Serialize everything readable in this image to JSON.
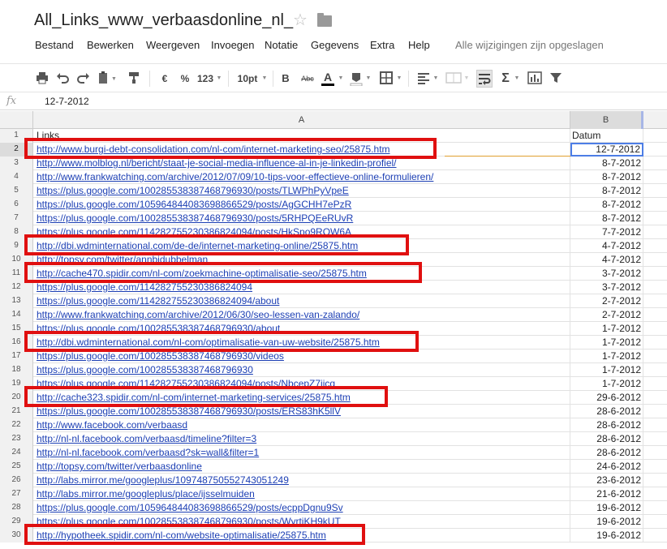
{
  "app": {
    "title": "All_Links_www_verbaasdonline_nl_",
    "save_status": "Alle wijzigingen zijn opgeslagen"
  },
  "menu": [
    "Bestand",
    "Bewerken",
    "Weergeven",
    "Invoegen",
    "Notatie",
    "Gegevens",
    "Extra",
    "Help"
  ],
  "toolbar": {
    "currency": "€",
    "percent": "%",
    "number_format": "123",
    "font_size": "10pt",
    "bold": "B",
    "strike": "Abc",
    "text_color": "A"
  },
  "formula": {
    "fx": "fx",
    "value": "12-7-2012"
  },
  "columns": {
    "a": "A",
    "b": "B"
  },
  "accent_colors": {
    "link": "#1c3fb4",
    "highlight_box": "#e01010",
    "selection": "#4d7ee6"
  },
  "rows": [
    {
      "n": "1",
      "a": "Links",
      "b": "Datum",
      "link": false
    },
    {
      "n": "2",
      "a": "http://www.burgi-debt-consolidation.com/nl-com/internet-marketing-seo/25875.htm",
      "b": "12-7-2012",
      "link": true
    },
    {
      "n": "3",
      "a": "http://www.molblog.nl/bericht/staat-je-social-media-influence-al-in-je-linkedin-profiel/",
      "b": "8-7-2012",
      "link": true
    },
    {
      "n": "4",
      "a": "http://www.frankwatching.com/archive/2012/07/09/10-tips-voor-effectieve-online-formulieren/",
      "b": "8-7-2012",
      "link": true
    },
    {
      "n": "5",
      "a": "https://plus.google.com/100285538387468796930/posts/TLWPhPyVpeE",
      "b": "8-7-2012",
      "link": true
    },
    {
      "n": "6",
      "a": "https://plus.google.com/105964844083698866529/posts/AgGCHH7ePzR",
      "b": "8-7-2012",
      "link": true
    },
    {
      "n": "7",
      "a": "https://plus.google.com/100285538387468796930/posts/5RHPQEeRUvR",
      "b": "8-7-2012",
      "link": true
    },
    {
      "n": "8",
      "a": "https://plus.google.com/114282755230386824094/posts/HkSpo9RQW6A",
      "b": "7-7-2012",
      "link": true
    },
    {
      "n": "9",
      "a": "http://dbi.wdminternational.com/de-de/internet-marketing-online/25875.htm",
      "b": "4-7-2012",
      "link": true
    },
    {
      "n": "10",
      "a": "http://topsy.com/twitter/annbidubbelman",
      "b": "4-7-2012",
      "link": true
    },
    {
      "n": "11",
      "a": "http://cache470.spidir.com/nl-com/zoekmachine-optimalisatie-seo/25875.htm",
      "b": "3-7-2012",
      "link": true
    },
    {
      "n": "12",
      "a": "https://plus.google.com/114282755230386824094",
      "b": "3-7-2012",
      "link": true
    },
    {
      "n": "13",
      "a": "https://plus.google.com/114282755230386824094/about",
      "b": "2-7-2012",
      "link": true
    },
    {
      "n": "14",
      "a": "http://www.frankwatching.com/archive/2012/06/30/seo-lessen-van-zalando/",
      "b": "2-7-2012",
      "link": true
    },
    {
      "n": "15",
      "a": "https://plus.google.com/100285538387468796930/about",
      "b": "1-7-2012",
      "link": true
    },
    {
      "n": "16",
      "a": "http://dbi.wdminternational.com/nl-com/optimalisatie-van-uw-website/25875.htm",
      "b": "1-7-2012",
      "link": true
    },
    {
      "n": "17",
      "a": "https://plus.google.com/100285538387468796930/videos",
      "b": "1-7-2012",
      "link": true
    },
    {
      "n": "18",
      "a": "https://plus.google.com/100285538387468796930",
      "b": "1-7-2012",
      "link": true
    },
    {
      "n": "19",
      "a": "https://plus.google.com/114282755230386824094/posts/NbcepZ7jicq",
      "b": "1-7-2012",
      "link": true
    },
    {
      "n": "20",
      "a": "http://cache323.spidir.com/nl-com/internet-marketing-services/25875.htm",
      "b": "29-6-2012",
      "link": true
    },
    {
      "n": "21",
      "a": "https://plus.google.com/100285538387468796930/posts/ERS83hK5llV",
      "b": "28-6-2012",
      "link": true
    },
    {
      "n": "22",
      "a": "http://www.facebook.com/verbaasd",
      "b": "28-6-2012",
      "link": true
    },
    {
      "n": "23",
      "a": "http://nl-nl.facebook.com/verbaasd/timeline?filter=3",
      "b": "28-6-2012",
      "link": true
    },
    {
      "n": "24",
      "a": "http://nl-nl.facebook.com/verbaasd?sk=wall&filter=1",
      "b": "28-6-2012",
      "link": true
    },
    {
      "n": "25",
      "a": "http://topsy.com/twitter/verbaasdonline",
      "b": "24-6-2012",
      "link": true
    },
    {
      "n": "26",
      "a": "http://labs.mirror.me/googleplus/109748750552743051249",
      "b": "23-6-2012",
      "link": true
    },
    {
      "n": "27",
      "a": "http://labs.mirror.me/googleplus/place/ijsselmuiden",
      "b": "21-6-2012",
      "link": true
    },
    {
      "n": "28",
      "a": "https://plus.google.com/105964844083698866529/posts/ecppDgnu9Sv",
      "b": "19-6-2012",
      "link": true
    },
    {
      "n": "29",
      "a": "https://plus.google.com/100285538387468796930/posts/WyrtjKH9kUT",
      "b": "19-6-2012",
      "link": true
    },
    {
      "n": "30",
      "a": "http://hypotheek.spidir.com/nl-com/website-optimalisatie/25875.htm",
      "b": "19-6-2012",
      "link": true
    }
  ]
}
